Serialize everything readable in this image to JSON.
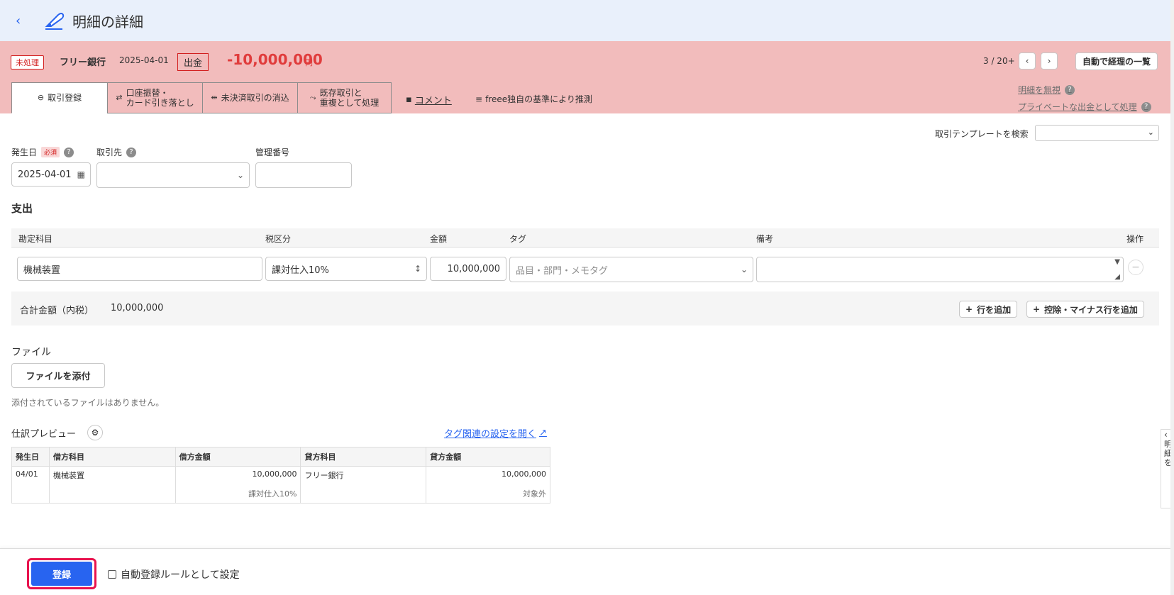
{
  "header": {
    "back_label": "‹",
    "title": "明細の詳細"
  },
  "band": {
    "status": "未処理",
    "bank": "フリー銀行",
    "date": "2025-04-01",
    "direction": "出金",
    "amount": "-10,000,000",
    "unit": "円",
    "pager": "3 / 20+",
    "prev": "‹",
    "next": "›",
    "list_button": "自動で経理の一覧"
  },
  "tabs": [
    {
      "icon": "⊖",
      "label": "取引登録"
    },
    {
      "icon": "⇄",
      "label": "口座振替・\nカード引き落とし"
    },
    {
      "icon": "⇹",
      "label": "未決済取引の消込"
    },
    {
      "icon": "⤳",
      "label": "既存取引と\n重複として処理"
    }
  ],
  "tab_links": {
    "comment": "コメント",
    "guess": "freee独自の基準により推測"
  },
  "side_links": {
    "ignore": "明細を無視",
    "private": "プライベートな出金として処理"
  },
  "form": {
    "template_label": "取引テンプレートを検索",
    "date_label": "発生日",
    "required": "必須",
    "partner_label": "取引先",
    "mgmt_label": "管理番号",
    "date_value": "2025-04-01",
    "partner_value": "",
    "mgmt_value": ""
  },
  "expense": {
    "title": "支出",
    "headers": {
      "account": "勘定科目",
      "tax": "税区分",
      "amount": "金額",
      "tag": "タグ",
      "note": "備考",
      "action": "操作"
    },
    "row": {
      "account": "機械装置",
      "tax": "課対仕入10%",
      "amount": "10,000,000",
      "tag_placeholder": "品目・部門・メモタグ",
      "note": ""
    },
    "total_label": "合計金額（内税）",
    "total_value": "10,000,000",
    "add_row": "行を追加",
    "add_minus_row": "控除・マイナス行を追加"
  },
  "file": {
    "title": "ファイル",
    "attach_button": "ファイルを添付",
    "empty": "添付されているファイルはありません。"
  },
  "preview": {
    "title": "仕訳プレビュー",
    "tag_link": "タグ関連の設定を開く",
    "headers": [
      "発生日",
      "借方科目",
      "借方金額",
      "貸方科目",
      "貸方金額"
    ],
    "rows": [
      {
        "date": "04/01",
        "debit_account": "機械装置",
        "debit_amount": "10,000,000",
        "debit_tax": "課対仕入10%",
        "credit_account": "フリー銀行",
        "credit_amount": "10,000,000",
        "credit_tax": "対象外"
      }
    ]
  },
  "footer": {
    "register": "登録",
    "auto_rule": "自動登録ルールとして設定"
  },
  "side_panel": {
    "text": "明細を"
  },
  "colors": {
    "band": "#f2bcbc",
    "header": "#e9f0fb",
    "primary": "#2864f0",
    "alert": "#e03c3c",
    "highlight": "#e8134e"
  }
}
